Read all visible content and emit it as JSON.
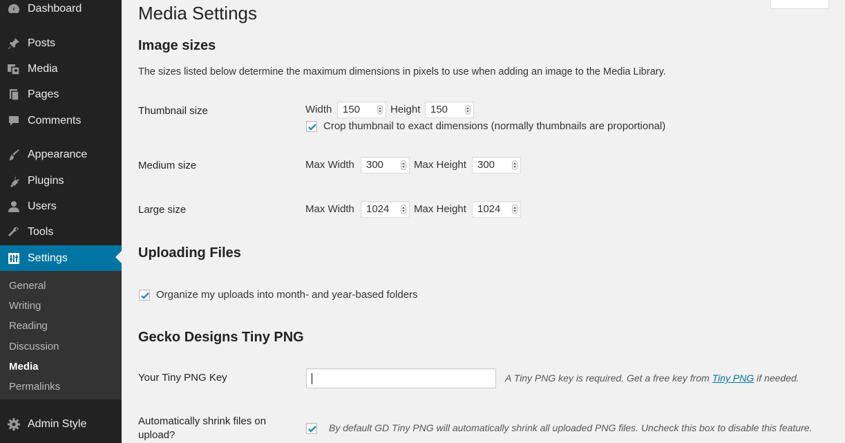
{
  "sidebar": {
    "items": [
      {
        "label": "Dashboard",
        "icon": "dashboard-icon"
      },
      {
        "label": "Posts",
        "icon": "pin-icon"
      },
      {
        "label": "Media",
        "icon": "media-icon"
      },
      {
        "label": "Pages",
        "icon": "pages-icon"
      },
      {
        "label": "Comments",
        "icon": "comment-icon"
      },
      {
        "label": "Appearance",
        "icon": "brush-icon"
      },
      {
        "label": "Plugins",
        "icon": "plug-icon"
      },
      {
        "label": "Users",
        "icon": "user-icon"
      },
      {
        "label": "Tools",
        "icon": "wrench-icon"
      },
      {
        "label": "Settings",
        "icon": "settings-icon"
      },
      {
        "label": "Admin Style",
        "icon": "gear-icon"
      }
    ],
    "active": "Settings",
    "submenu": [
      "General",
      "Writing",
      "Reading",
      "Discussion",
      "Media",
      "Permalinks"
    ],
    "submenu_current": "Media",
    "accent_color": "#0074a2"
  },
  "page": {
    "title": "Media Settings",
    "image_sizes": {
      "heading": "Image sizes",
      "description": "The sizes listed below determine the maximum dimensions in pixels to use when adding an image to the Media Library.",
      "thumbnail": {
        "label": "Thumbnail size",
        "width_label": "Width",
        "width": "150",
        "height_label": "Height",
        "height": "150",
        "crop_label": "Crop thumbnail to exact dimensions (normally thumbnails are proportional)",
        "crop_checked": true
      },
      "medium": {
        "label": "Medium size",
        "width_label": "Max Width",
        "width": "300",
        "height_label": "Max Height",
        "height": "300"
      },
      "large": {
        "label": "Large size",
        "width_label": "Max Width",
        "width": "1024",
        "height_label": "Max Height",
        "height": "1024"
      }
    },
    "uploading": {
      "heading": "Uploading Files",
      "organize_label": "Organize my uploads into month- and year-based folders",
      "organize_checked": true
    },
    "tinypng": {
      "heading": "Gecko Designs Tiny PNG",
      "key_label": "Your Tiny PNG Key",
      "key_value": "",
      "key_help_before": "A Tiny PNG key is required. Get a free key from ",
      "key_help_link": "Tiny PNG",
      "key_help_after": " if needed.",
      "shrink_label_line1": "Automatically shrink files on",
      "shrink_label_line2": "upload?",
      "shrink_checked": true,
      "shrink_help": "By default GD Tiny PNG will automatically shrink all uploaded PNG files. Uncheck this box to disable this feature."
    }
  }
}
